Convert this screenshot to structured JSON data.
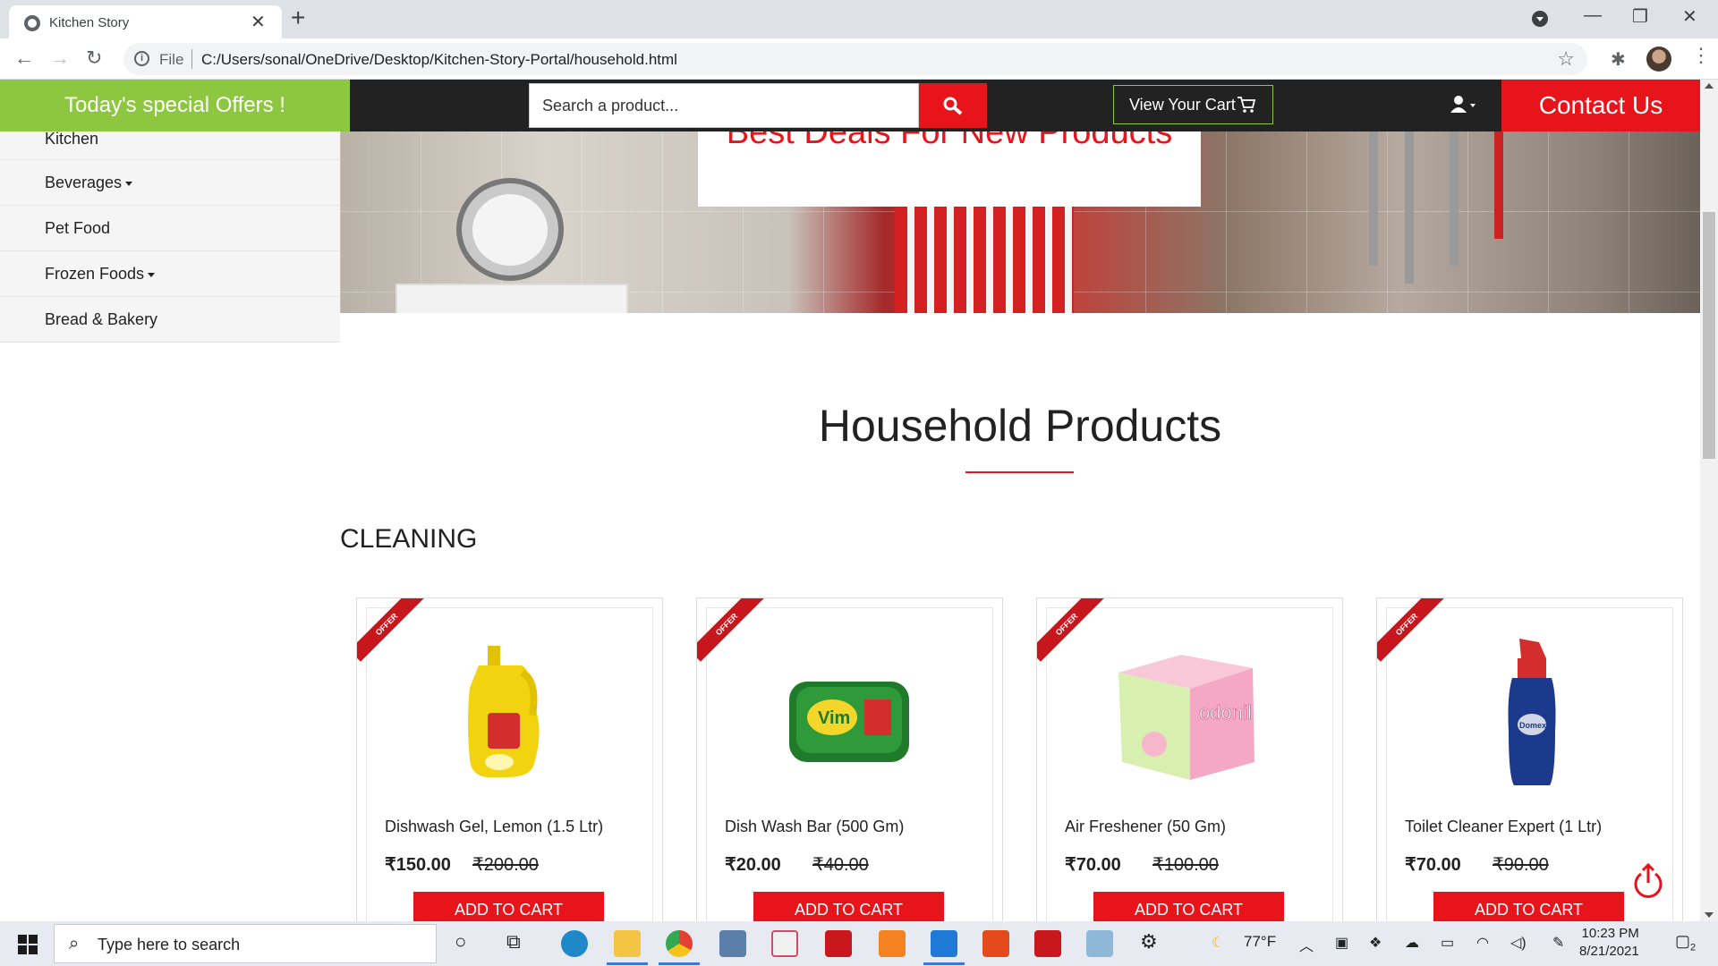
{
  "browser": {
    "tab_title": "Kitchen Story",
    "tab_close": "✕",
    "new_tab": "+",
    "address_scheme": "File",
    "address_url": "C:/Users/sonal/OneDrive/Desktop/Kitchen-Story-Portal/household.html",
    "window_controls": {
      "minimize": "—",
      "maximize": "❐",
      "close": "✕"
    }
  },
  "site_nav": {
    "offers": "Today's special Offers !",
    "search_placeholder": "Search a product...",
    "cart": "View Your Cart",
    "contact": "Contact Us"
  },
  "sidebar": {
    "items": [
      {
        "label": "Kitchen",
        "dropdown": false
      },
      {
        "label": "Beverages",
        "dropdown": true
      },
      {
        "label": "Pet Food",
        "dropdown": false
      },
      {
        "label": "Frozen Foods",
        "dropdown": true
      },
      {
        "label": "Bread & Bakery",
        "dropdown": false
      }
    ]
  },
  "banner": {
    "headline": "Best Deals For New Products"
  },
  "main": {
    "title": "Household Products",
    "category": "CLEANING",
    "offer_ribbon": "OFFER",
    "add_to_cart": "ADD TO CART",
    "products": [
      {
        "name": "Dishwash Gel, Lemon (1.5 Ltr)",
        "price": "₹150.00",
        "mrp": "₹200.00",
        "image": "yellow-bottle"
      },
      {
        "name": "Dish Wash Bar (500 Gm)",
        "price": "₹20.00",
        "mrp": "₹40.00",
        "image": "green-tub"
      },
      {
        "name": "Air Freshener (50 Gm)",
        "price": "₹70.00",
        "mrp": "₹100.00",
        "image": "pink-box"
      },
      {
        "name": "Toilet Cleaner Expert (1 Ltr)",
        "price": "₹70.00",
        "mrp": "₹90.00",
        "image": "blue-bottle"
      }
    ]
  },
  "taskbar": {
    "search_placeholder": "Type here to search",
    "weather": "77°F",
    "time": "10:23 PM",
    "date": "8/21/2021",
    "notifications": "2"
  },
  "colors": {
    "brand_green": "#8dc63f",
    "brand_red": "#e8141b",
    "nav_dark": "#222222"
  }
}
